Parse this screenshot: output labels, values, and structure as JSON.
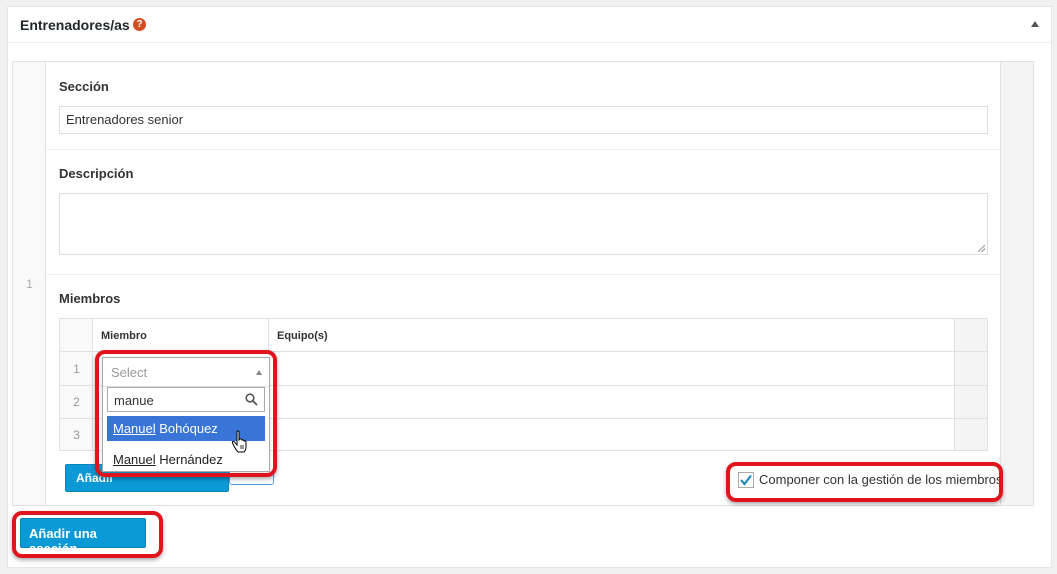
{
  "panel": {
    "title": "Entrenadores/as",
    "help_icon": "question-circle-icon",
    "toggle_icon": "triangle-up-icon"
  },
  "row": {
    "number": "1",
    "section_label": "Sección",
    "section_value": "Entrenadores senior",
    "description_label": "Descripción",
    "description_value": "",
    "members_label": "Miembros"
  },
  "members_table": {
    "columns": [
      "Miembro",
      "Equipo(s)"
    ],
    "row_numbers": [
      "1",
      "2",
      "3"
    ],
    "add_button_label": "Añadir"
  },
  "dropdown": {
    "placeholder": "Select",
    "search_value": "manue",
    "options": [
      {
        "match": "Manuel",
        "rest": " Bohóquez",
        "active": true
      },
      {
        "match": "Manuel",
        "rest": " Hernández",
        "active": false
      }
    ]
  },
  "compose_checkbox": {
    "label": "Componer con la gestión de los miembros",
    "checked": true
  },
  "add_section_label": "Añadir una sección",
  "colors": {
    "accent": "#0c9ad6",
    "highlight": "#e0141d",
    "option_active": "#3875d7"
  }
}
